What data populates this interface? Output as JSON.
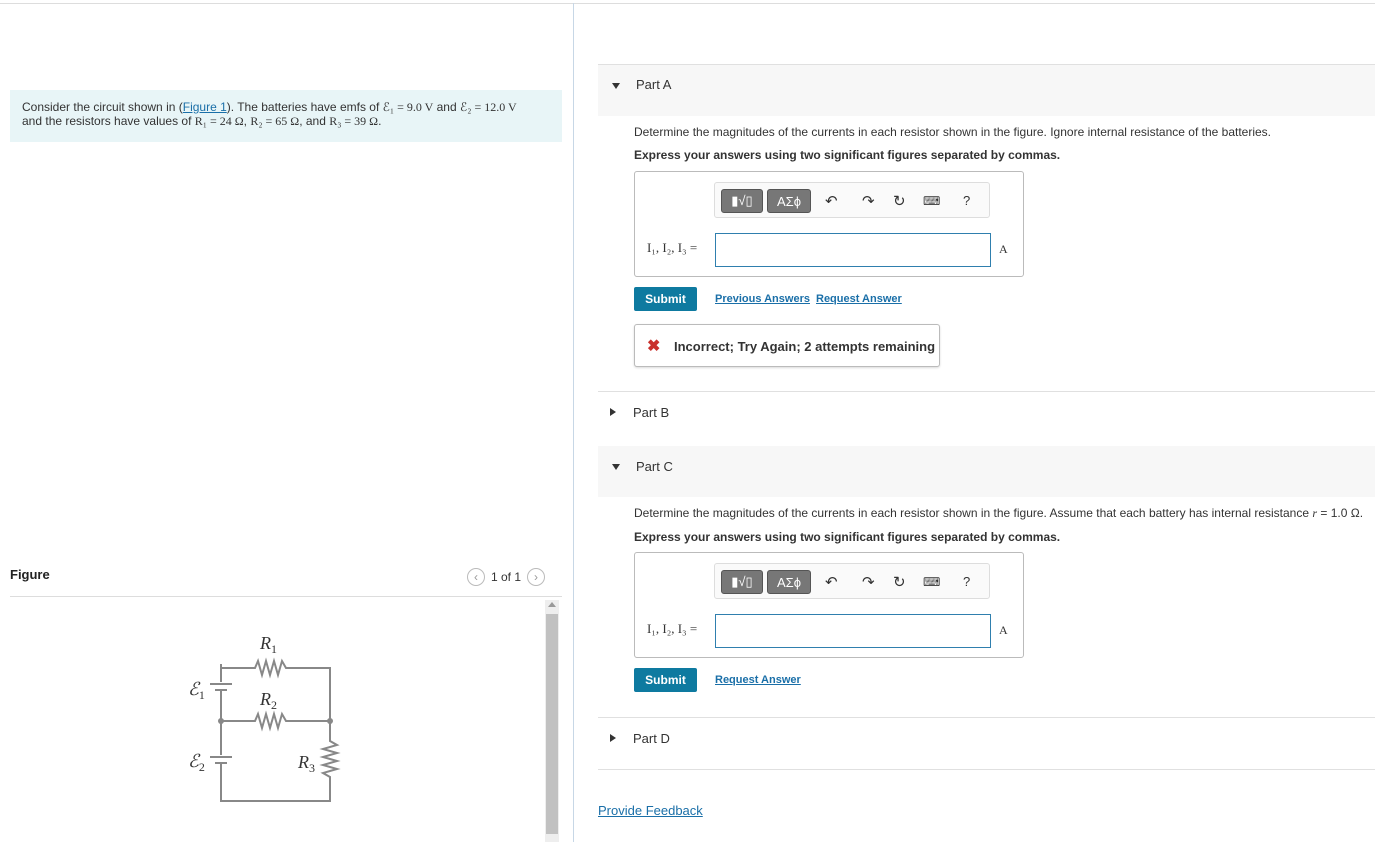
{
  "problem": {
    "text_before": "Consider the circuit shown in (",
    "figure_link": "Figure 1",
    "text_mid": "). The batteries have emfs of ",
    "emf1": "ℰ₁ = 9.0 V",
    "and1": " and ",
    "emf2": "ℰ₂ = 12.0 V",
    "line2_a": "and the resistors have values of ",
    "r1": "R₁ = 24 Ω",
    "comma1": ", ",
    "r2": "R₂ = 65 Ω",
    "and2": ", and ",
    "r3": "R₃ = 39 Ω",
    "period": "."
  },
  "figure": {
    "title": "Figure",
    "pager": "1 of 1",
    "prev_icon": "chevron-left-icon",
    "next_icon": "chevron-right-icon",
    "labels": {
      "r1": "R",
      "r1_sub": "1",
      "r2": "R",
      "r2_sub": "2",
      "r3": "R",
      "r3_sub": "3",
      "e1": "ℰ",
      "e1_sub": "1",
      "e2": "ℰ",
      "e2_sub": "2"
    }
  },
  "parts": {
    "a": {
      "label": "Part A",
      "question": "Determine the magnitudes of the currents in each resistor shown in the figure. Ignore internal resistance of the batteries.",
      "instruction": "Express your answers using two significant figures separated by commas.",
      "eq_label": "I₁, I₂, I₃ =",
      "input_value": "",
      "unit": "A",
      "submit": "Submit",
      "prev_answers": "Previous Answers",
      "request_answer": "Request Answer",
      "feedback": "Incorrect; Try Again; 2 attempts remaining"
    },
    "b": {
      "label": "Part B"
    },
    "c": {
      "label": "Part C",
      "question_a": "Determine the magnitudes of the currents in each resistor shown in the figure. Assume that each battery has internal resistance ",
      "question_r": "r",
      "question_b": " = 1.0 Ω.",
      "instruction": "Express your answers using two significant figures separated by commas.",
      "eq_label": "I₁, I₂, I₃ =",
      "input_value": "",
      "unit": "A",
      "submit": "Submit",
      "request_answer": "Request Answer"
    },
    "d": {
      "label": "Part D"
    }
  },
  "toolbar": {
    "template_btn": "▮√▯",
    "symbol_btn": "ΑΣϕ",
    "help": "?",
    "icons": [
      "undo-icon",
      "redo-icon",
      "reset-icon",
      "keyboard-icon",
      "help-icon"
    ]
  },
  "footer": {
    "provide_feedback": "Provide Feedback"
  },
  "colors": {
    "accent": "#0e7aa0",
    "link": "#1a6fa8",
    "error": "#c9302c",
    "problem_bg": "#e8f5f7"
  }
}
